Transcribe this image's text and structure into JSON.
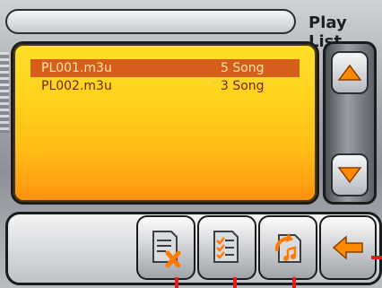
{
  "header": {
    "title": "Play List"
  },
  "playlist": {
    "items": [
      {
        "name": "PL001.m3u",
        "count": "5 Song",
        "selected": true
      },
      {
        "name": "PL002.m3u",
        "count": "3 Song",
        "selected": false
      }
    ]
  },
  "scroll": {
    "up_icon": "triangle-up-icon",
    "down_icon": "triangle-down-icon"
  },
  "toolbar": {
    "buttons": [
      {
        "icon": "delete-playlist-icon"
      },
      {
        "icon": "checklist-icon"
      },
      {
        "icon": "load-playlist-icon"
      },
      {
        "icon": "back-arrow-icon"
      }
    ]
  },
  "colors": {
    "accent_orange": "#ff9f12",
    "panel_yellow": "#ffe02a",
    "selected_row": "#d55f1a",
    "arrow_orange": "#ff8a00",
    "marker_red": "#e31b1b"
  }
}
